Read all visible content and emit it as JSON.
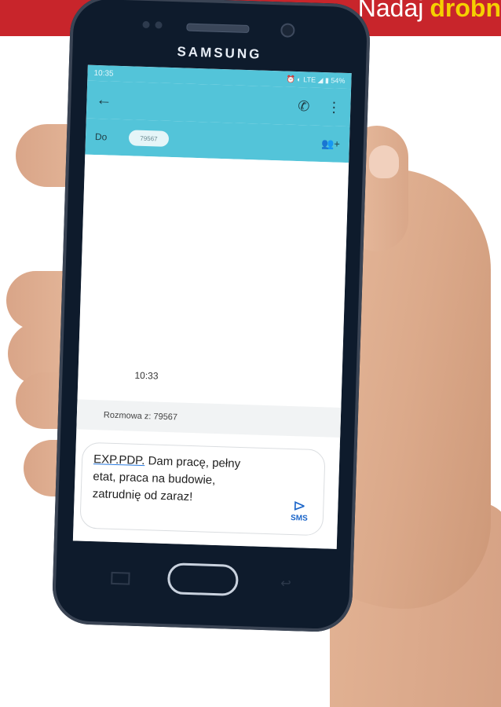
{
  "banner": {
    "prefix": "Nadaj",
    "emphasis": "drobn"
  },
  "phone": {
    "brand": "SAMSUNG"
  },
  "status_bar": {
    "time": "10:35",
    "icons": "⏰ ◐ LTE ◢ ▮ 54%"
  },
  "app_bar": {
    "back_icon": "←",
    "call_icon": "✆",
    "menu_icon": "⋮"
  },
  "recipient": {
    "label": "Do",
    "chip": "79567",
    "add_icon": "👥+"
  },
  "thread": {
    "time": "10:33",
    "conversation_label": "Rozmowa z: 79567"
  },
  "compose": {
    "prefix": "EXP.PDP.",
    "message": " Dam pracę, pełny etat, praca na budowie, zatrudnię od zaraz!",
    "send_icon": "⊳",
    "send_label": "SMS"
  },
  "colors": {
    "accent": "#53c4d9",
    "banner": "#c8252b",
    "highlight": "#f5d000"
  }
}
